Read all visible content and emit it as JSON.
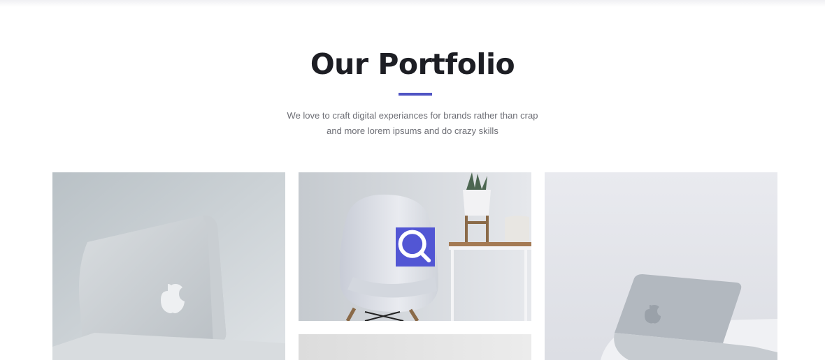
{
  "section": {
    "title": "Our Portfolio",
    "subtitle_line1": "We love to craft digital experiances for brands rather than crap",
    "subtitle_line2": "and more lorem ipsums and do crazy skills"
  },
  "colors": {
    "accent": "#5256d4",
    "title": "#1d1e24",
    "text": "#6d6e75"
  },
  "portfolio": {
    "items": [
      {
        "image": "laptop-closed-grey-wall"
      },
      {
        "image": "white-chair-side-table-plant",
        "overlay_icon": "search-icon"
      },
      {
        "image": "laptop-on-white-table"
      },
      {
        "image": "grey-surface"
      }
    ]
  }
}
